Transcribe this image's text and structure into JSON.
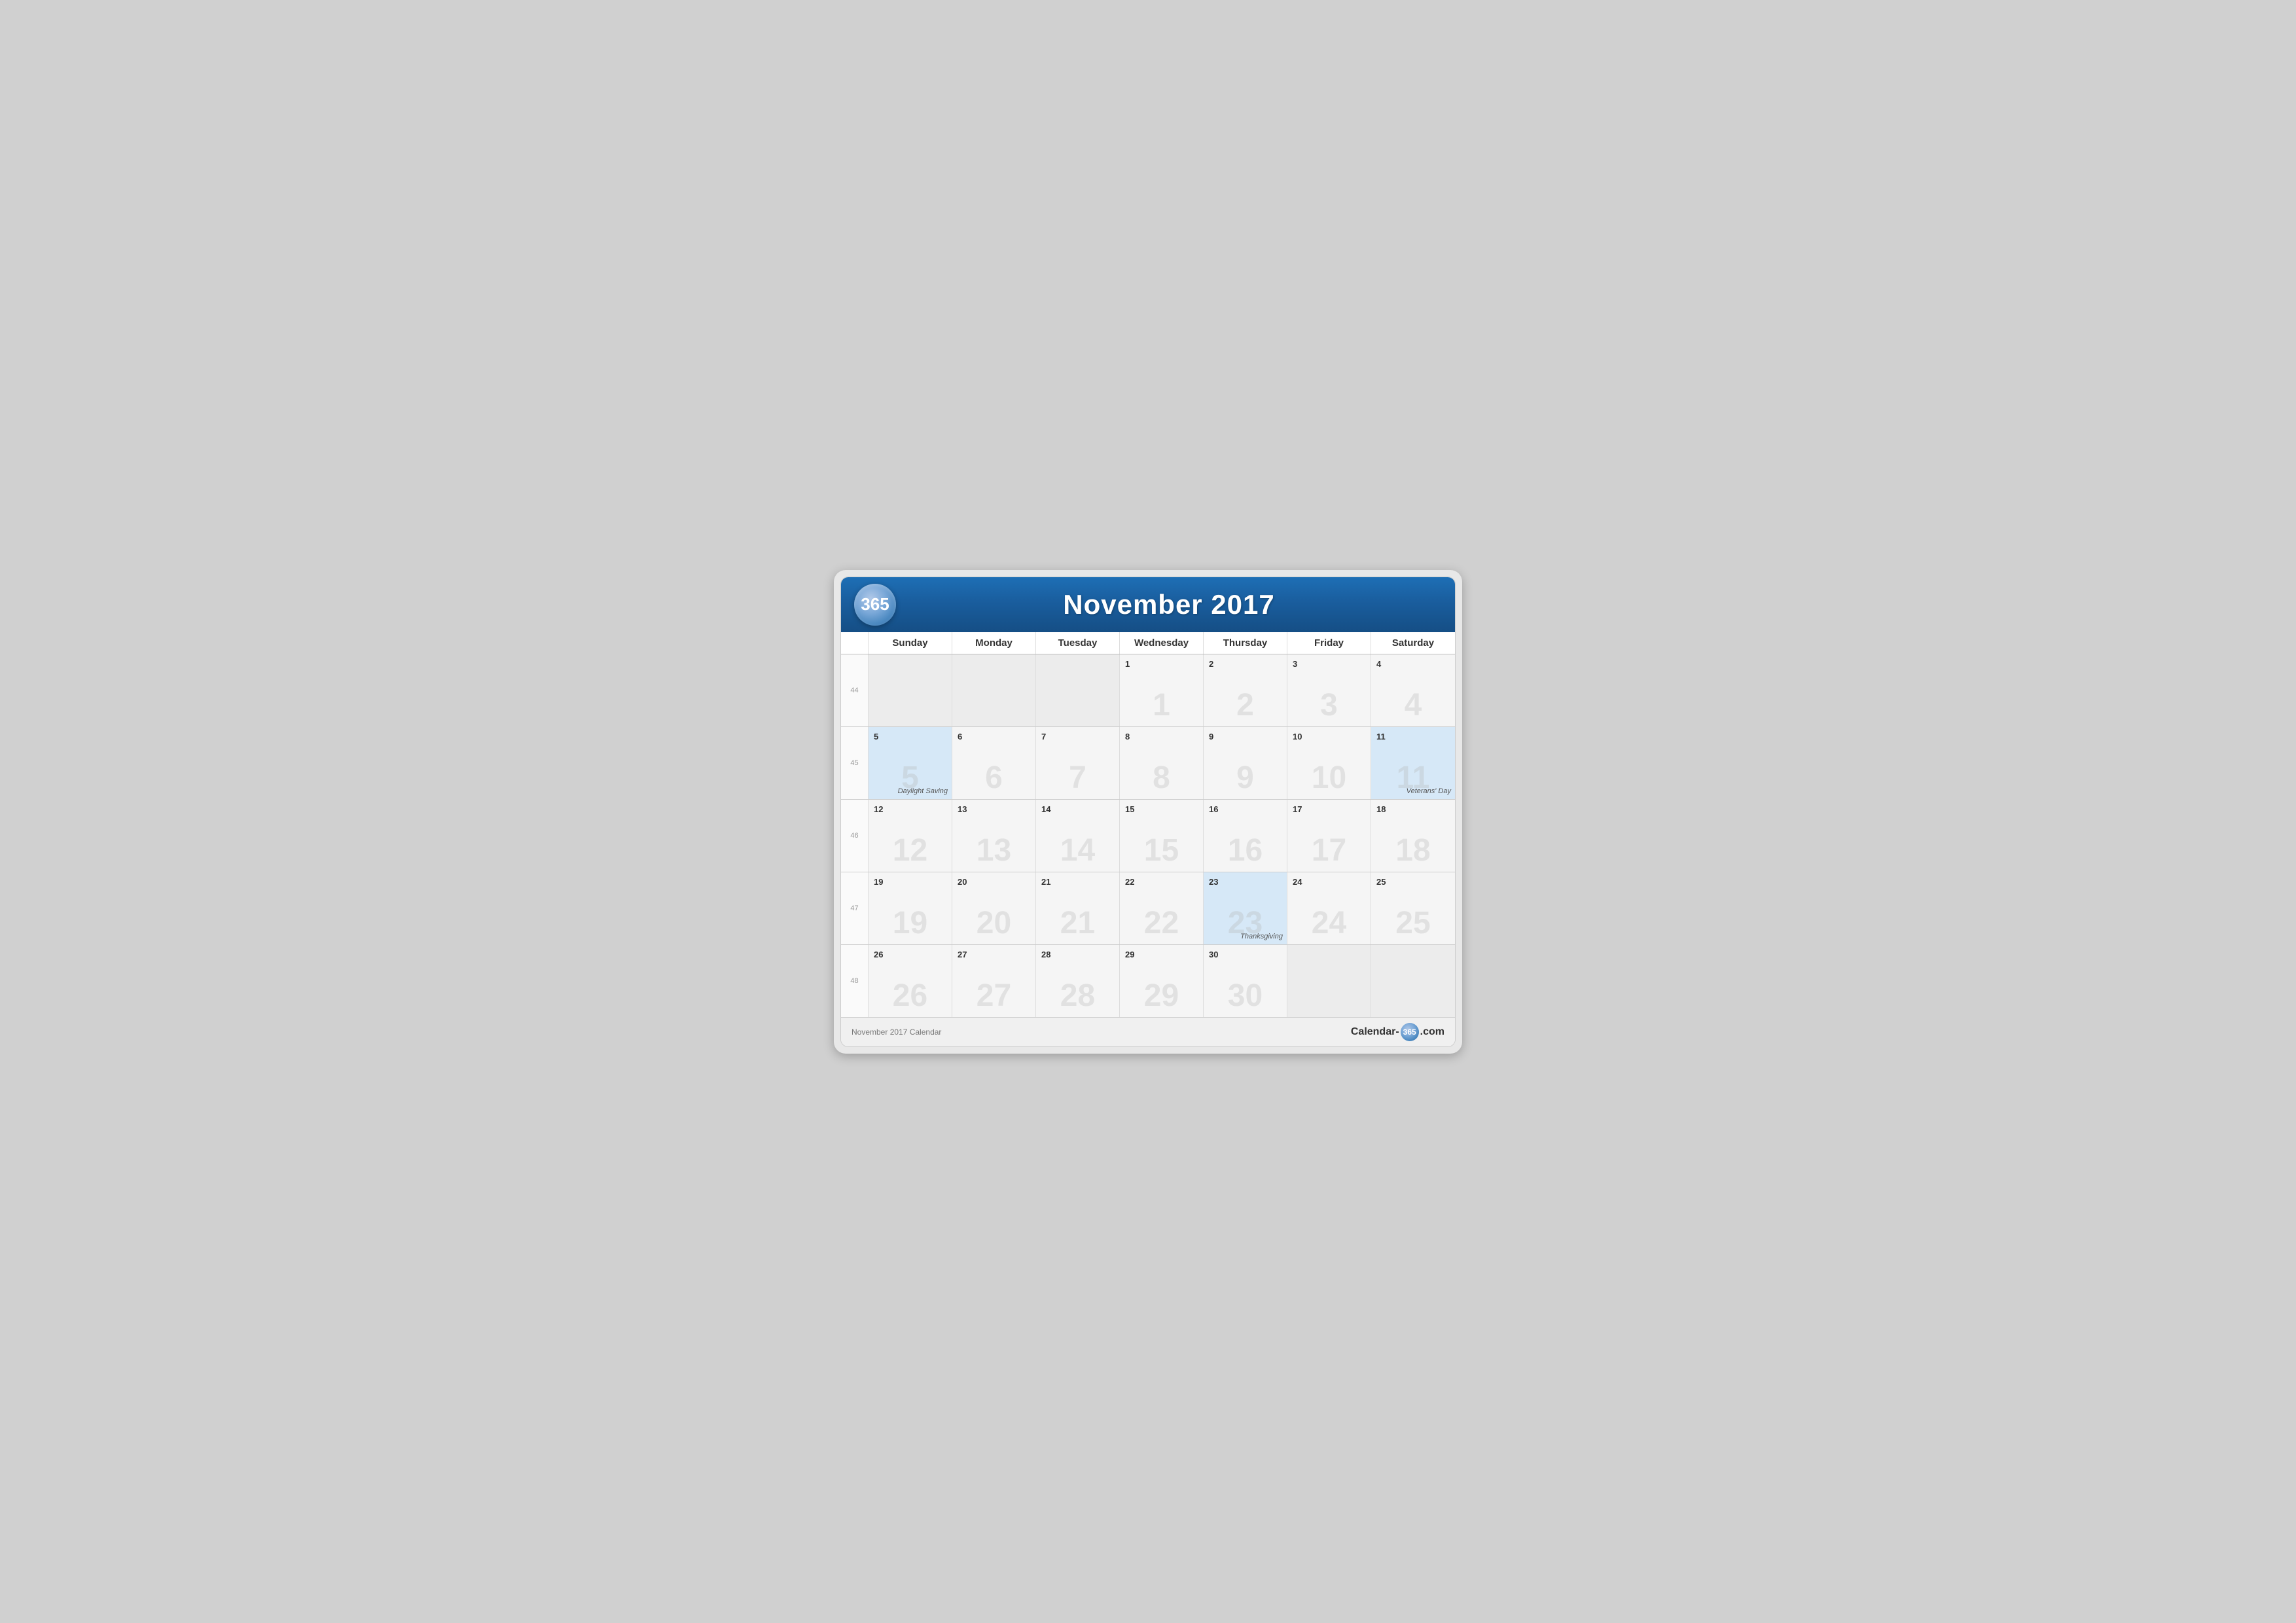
{
  "header": {
    "logo": "365",
    "title": "November 2017"
  },
  "days_of_week": [
    "Sunday",
    "Monday",
    "Tuesday",
    "Wednesday",
    "Thursday",
    "Friday",
    "Saturday"
  ],
  "weeks": [
    {
      "week_num": "44",
      "days": [
        {
          "num": "",
          "empty": true
        },
        {
          "num": "",
          "empty": true
        },
        {
          "num": "",
          "empty": true
        },
        {
          "num": "1",
          "empty": false
        },
        {
          "num": "2",
          "empty": false
        },
        {
          "num": "3",
          "empty": false
        },
        {
          "num": "4",
          "empty": false
        }
      ]
    },
    {
      "week_num": "45",
      "days": [
        {
          "num": "5",
          "empty": false,
          "highlight": true,
          "event": "Daylight Saving",
          "watermark": "5"
        },
        {
          "num": "6",
          "empty": false
        },
        {
          "num": "7",
          "empty": false
        },
        {
          "num": "8",
          "empty": false
        },
        {
          "num": "9",
          "empty": false
        },
        {
          "num": "10",
          "empty": false
        },
        {
          "num": "11",
          "empty": false,
          "highlight": true,
          "event": "Veterans' Day"
        }
      ]
    },
    {
      "week_num": "46",
      "days": [
        {
          "num": "12",
          "empty": false
        },
        {
          "num": "13",
          "empty": false
        },
        {
          "num": "14",
          "empty": false
        },
        {
          "num": "15",
          "empty": false
        },
        {
          "num": "16",
          "empty": false
        },
        {
          "num": "17",
          "empty": false
        },
        {
          "num": "18",
          "empty": false
        }
      ]
    },
    {
      "week_num": "47",
      "days": [
        {
          "num": "19",
          "empty": false
        },
        {
          "num": "20",
          "empty": false
        },
        {
          "num": "21",
          "empty": false
        },
        {
          "num": "22",
          "empty": false
        },
        {
          "num": "23",
          "empty": false,
          "highlight": true,
          "event": "Thanksgiving"
        },
        {
          "num": "24",
          "empty": false
        },
        {
          "num": "25",
          "empty": false
        }
      ]
    },
    {
      "week_num": "48",
      "days": [
        {
          "num": "26",
          "empty": false
        },
        {
          "num": "27",
          "empty": false
        },
        {
          "num": "28",
          "empty": false
        },
        {
          "num": "29",
          "empty": false
        },
        {
          "num": "30",
          "empty": false
        },
        {
          "num": "",
          "empty": true
        },
        {
          "num": "",
          "empty": true
        }
      ]
    }
  ],
  "footer": {
    "left_text": "November 2017 Calendar",
    "right_prefix": "Calendar-",
    "right_365": "365",
    "right_suffix": ".com"
  },
  "watermarks": {
    "2": "2",
    "3": "3",
    "4": "4",
    "6": "6",
    "7": "7",
    "8": "8",
    "9": "9",
    "10": "10",
    "12": "12",
    "13": "13",
    "14": "14",
    "15": "15",
    "16": "16",
    "17": "17",
    "18": "18",
    "19": "19",
    "20": "20",
    "21": "21",
    "22": "22",
    "24": "24",
    "25": "25",
    "26": "26",
    "27": "27",
    "28": "28",
    "29": "29",
    "30": "30"
  }
}
